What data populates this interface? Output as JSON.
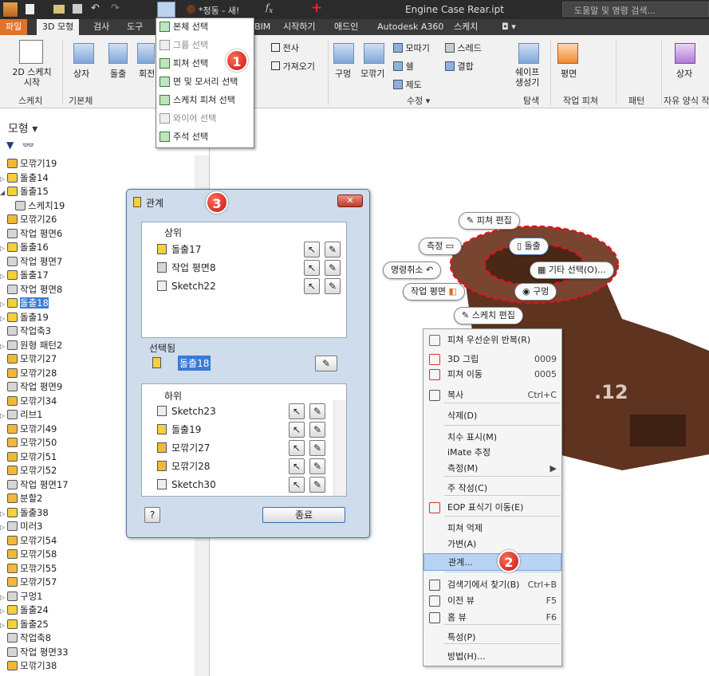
{
  "titlebar": {
    "doc_name": "*청동 - 새!",
    "file_title": "Engine Case Rear.ipt",
    "help_search": "도움말 및 명령 검색..."
  },
  "tabs": [
    "파일",
    "3D 모형",
    "검사",
    "도구",
    "BIM",
    "시작하기",
    "애드인",
    "Autodesk A360",
    "스케치"
  ],
  "ribbon": {
    "sketch_button": "2D 스케치\n시작",
    "box_label": "상자",
    "extrude_label": "돌출",
    "revolve_label": "회전",
    "derive_label": "전사",
    "import_label": "가져오기",
    "hole_label": "구멍",
    "fillet_label": "모깎기",
    "chamfer_label": "모따기",
    "shell_label": "쉘",
    "delete_label": "제도",
    "thread_label": "스레드",
    "combine_label": "결합",
    "shape_gen_label": "쉐이프\n생성기",
    "plane_label": "평면",
    "freeform_box_label": "상자",
    "groups": [
      "스케치",
      "기본체",
      "수정 ▾",
      "탐색",
      "작업 피쳐",
      "패턴",
      "자유 양식 작"
    ]
  },
  "dropdown_items": [
    "본체 선택",
    "그룹 선택",
    "피쳐 선택",
    "면 및 모서리 선택",
    "스케치 피쳐 선택",
    "와이어 선택",
    "주석 선택"
  ],
  "browser": {
    "title": "모형 ▾",
    "items": [
      "모깎기19",
      "돌출14",
      "돌출15",
      "스케치19",
      "모깎기26",
      "작업 평면6",
      "돌출16",
      "작업 평면7",
      "돌출17",
      "작업 평면8",
      "돌출18",
      "돌출19",
      "작업축3",
      "원형 패턴2",
      "모깎기27",
      "모깎기28",
      "작업 평면9",
      "모깎기34",
      "리브1",
      "모깎기49",
      "모깎기50",
      "모깎기51",
      "모깎기52",
      "작업 평면17",
      "분할2",
      "돌출38",
      "미러3",
      "모깎기54",
      "모깎기58",
      "모깎기55",
      "모깎기57",
      "구멍1",
      "돌출24",
      "돌출25",
      "작업축8",
      "작업 평면33",
      "모깎기38"
    ]
  },
  "dialog": {
    "title": "관계",
    "parents_header": "상위",
    "parents": [
      "돌출17",
      "작업 평면8",
      "Sketch22"
    ],
    "selected_header": "선택됨",
    "selected": "돌출18",
    "children_header": "하위",
    "children": [
      "Sketch23",
      "돌출19",
      "모깎기27",
      "모깎기28",
      "Sketch30"
    ],
    "help_label": "?",
    "close_label": "종료"
  },
  "marking_menu": {
    "edit_feature": "피쳐 편집",
    "measure": "측정",
    "extrude": "돌출",
    "cancel": "명령취소",
    "other_select": "기타 선택(O)...",
    "work_plane": "작업 평면",
    "hole": "구멍",
    "edit_sketch": "스케치 편집"
  },
  "context_menu": [
    {
      "label": "피쳐 우선순위 반복(R)",
      "shortcut": ""
    },
    {
      "label": "3D 그립",
      "shortcut": "0009"
    },
    {
      "label": "피쳐 이동",
      "shortcut": "0005"
    },
    {
      "label": "복사",
      "shortcut": "Ctrl+C"
    },
    {
      "label": "삭제(D)",
      "shortcut": ""
    },
    {
      "label": "치수 표시(M)",
      "shortcut": ""
    },
    {
      "label": "iMate 추정",
      "shortcut": ""
    },
    {
      "label": "측정(M)",
      "shortcut": "▶"
    },
    {
      "label": "주 작성(C)",
      "shortcut": ""
    },
    {
      "label": "EOP 표식기 이동(E)",
      "shortcut": ""
    },
    {
      "label": "피쳐 억제",
      "shortcut": ""
    },
    {
      "label": "가변(A)",
      "shortcut": ""
    },
    {
      "label": "관계...",
      "shortcut": ""
    },
    {
      "label": "검색기에서 찾기(B)",
      "shortcut": "Ctrl+B"
    },
    {
      "label": "이전 뷰",
      "shortcut": "F5"
    },
    {
      "label": "홈 뷰",
      "shortcut": "F6"
    },
    {
      "label": "특성(P)",
      "shortcut": ""
    },
    {
      "label": "방법(H)...",
      "shortcut": ""
    }
  ],
  "part_text": ".12",
  "badges": [
    "1",
    "2",
    "3"
  ]
}
